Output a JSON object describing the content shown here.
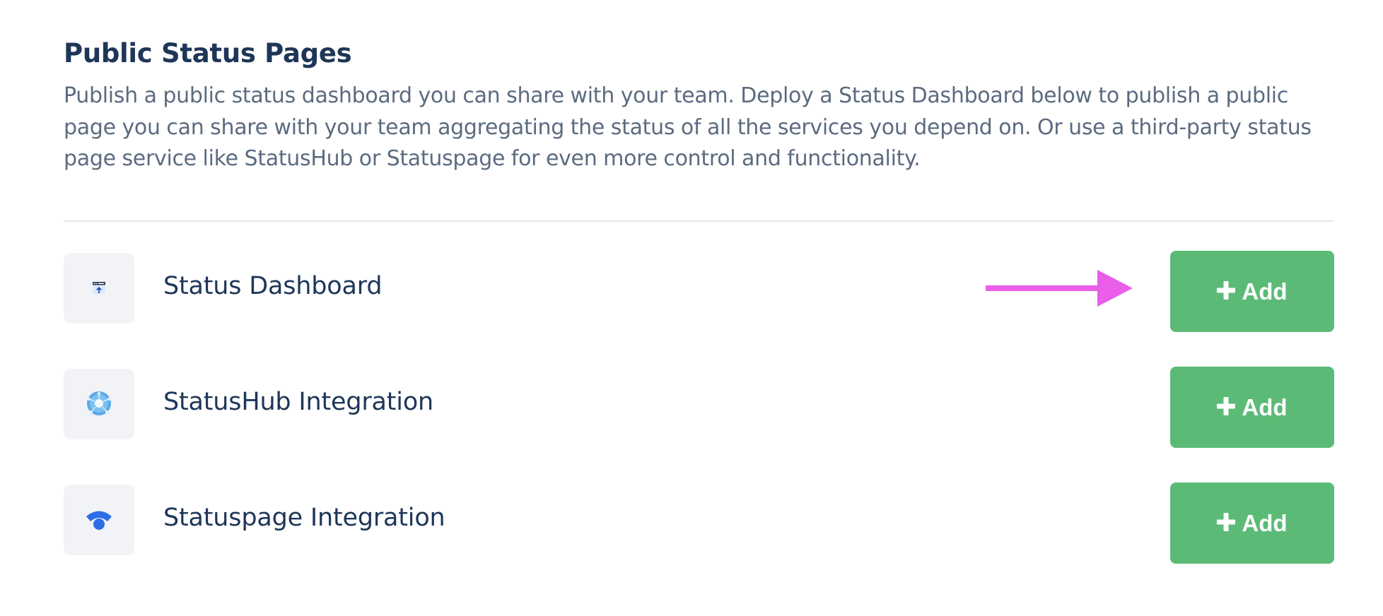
{
  "section": {
    "title": "Public Status Pages",
    "description": "Publish a public status dashboard you can share with your team. Deploy a Status Dashboard below to publish a public page you can share with your team aggregating the status of all the services you depend on. Or use a third-party status page service like StatusHub or Statuspage for even more control and functionality."
  },
  "integrations": [
    {
      "label": "Status Dashboard",
      "icon": "status-dashboard-icon",
      "button_label": "Add"
    },
    {
      "label": "StatusHub Integration",
      "icon": "statushub-icon",
      "button_label": "Add"
    },
    {
      "label": "Statuspage Integration",
      "icon": "statuspage-icon",
      "button_label": "Add"
    }
  ],
  "annotation": {
    "icon": "pointer-arrow-icon",
    "color": "#e95de9"
  },
  "colors": {
    "add_button": "#5bbb76",
    "heading": "#1e3658",
    "body_text": "#5b6b80"
  }
}
